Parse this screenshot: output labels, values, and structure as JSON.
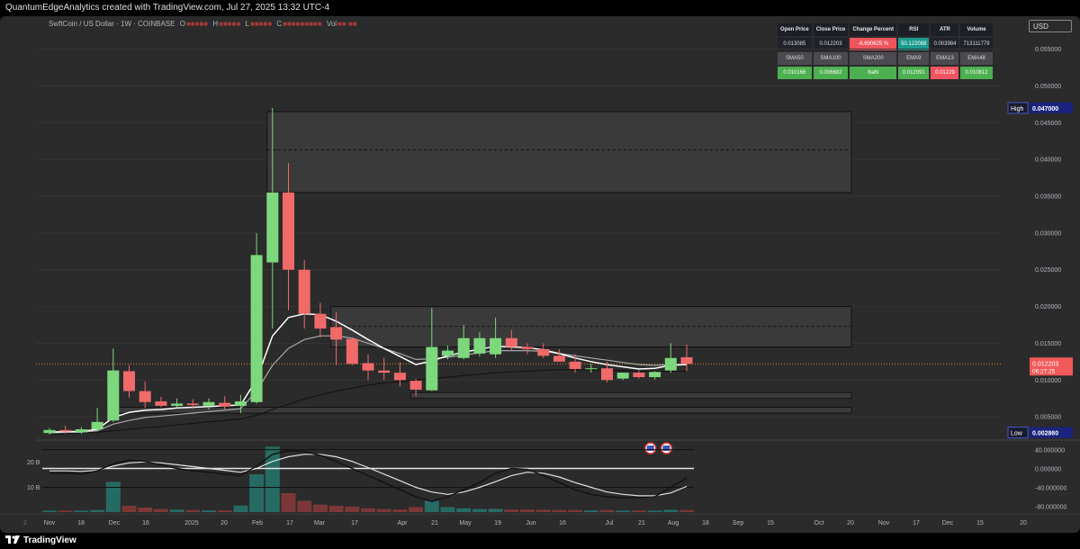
{
  "header": {
    "credit": "QuantumEdgeAnalytics created with TradingView.com, Jul 27, 2025 13:32 UTC-4",
    "symbol": "SwftCoin / US Dollar · 1W · COINBASE",
    "ohlc_labels": [
      "O",
      "H",
      "L",
      "C"
    ],
    "volume_label": "Vol",
    "currency": "USD",
    "brand": "TradingView"
  },
  "stats_table": {
    "headers": [
      "Open Price",
      "Close Price",
      "Change Percent",
      "RSI",
      "ATR",
      "Volume"
    ],
    "values": [
      "0.013085",
      "0.012203",
      "-6.690625 %",
      "50.122088",
      "0.003984",
      "713111779"
    ],
    "ma_headers": [
      "SMA50",
      "SMA100",
      "SMA200",
      "EMA9",
      "EMA13",
      "EMA48"
    ],
    "ma_values": [
      "0.010166",
      "0.006682",
      "NaN",
      "0.012091",
      "0.01229",
      "0.010812"
    ],
    "colors": {
      "negative": "#f0555f",
      "rsi": "#1b9b8e",
      "positive": "#4caf50"
    }
  },
  "chart_data": [
    {
      "type": "candlestick",
      "title": "SwftCoin / US Dollar · 1W · COINBASE",
      "ylim": [
        0.0022,
        0.0585
      ],
      "y_ticks": [
        "0.055000",
        "0.050000",
        "0.045000",
        "0.040000",
        "0.035000",
        "0.030000",
        "0.025000",
        "0.020000",
        "0.015000",
        "0.010000",
        "0.005000"
      ],
      "x_tick_labels": [
        "Nov",
        "18",
        "Dec",
        "16",
        "2025",
        "20",
        "Feb",
        "17",
        "Mar",
        "17",
        "Apr",
        "21",
        "May",
        "19",
        "Jun",
        "16",
        "Jul",
        "21",
        "Aug",
        "18",
        "Sep",
        "15",
        "Oct",
        "20",
        "Nov",
        "17",
        "Dec",
        "15",
        "20"
      ],
      "markers": {
        "high": {
          "label": "High",
          "value": "0.047000"
        },
        "low": {
          "label": "Low",
          "value": "0.002860"
        },
        "last": {
          "value": "0.012203",
          "countdown": "06:27:25"
        }
      },
      "colors": {
        "up": "#7dd87d",
        "down": "#f06a6a",
        "ema_fast": "#ffffff",
        "ema_slow": "#a8a8a8",
        "sma_long": "#111111",
        "last_line": "#d9883a"
      },
      "candles": [
        {
          "o": 0.0028,
          "h": 0.0035,
          "l": 0.0026,
          "c": 0.0032
        },
        {
          "o": 0.0032,
          "h": 0.0038,
          "l": 0.0027,
          "c": 0.003
        },
        {
          "o": 0.0029,
          "h": 0.0036,
          "l": 0.0027,
          "c": 0.0033
        },
        {
          "o": 0.0033,
          "h": 0.0062,
          "l": 0.0031,
          "c": 0.0043
        },
        {
          "o": 0.0045,
          "h": 0.0143,
          "l": 0.0043,
          "c": 0.0113
        },
        {
          "o": 0.0112,
          "h": 0.012,
          "l": 0.0076,
          "c": 0.0085
        },
        {
          "o": 0.0085,
          "h": 0.0098,
          "l": 0.0062,
          "c": 0.007
        },
        {
          "o": 0.0071,
          "h": 0.0077,
          "l": 0.0063,
          "c": 0.0065
        },
        {
          "o": 0.0065,
          "h": 0.0075,
          "l": 0.0062,
          "c": 0.0068
        },
        {
          "o": 0.0068,
          "h": 0.0074,
          "l": 0.0061,
          "c": 0.0066
        },
        {
          "o": 0.0065,
          "h": 0.0075,
          "l": 0.006,
          "c": 0.007
        },
        {
          "o": 0.0069,
          "h": 0.0078,
          "l": 0.006,
          "c": 0.0064
        },
        {
          "o": 0.0065,
          "h": 0.008,
          "l": 0.0055,
          "c": 0.0071
        },
        {
          "o": 0.007,
          "h": 0.03,
          "l": 0.0068,
          "c": 0.027
        },
        {
          "o": 0.026,
          "h": 0.047,
          "l": 0.017,
          "c": 0.0355
        },
        {
          "o": 0.0355,
          "h": 0.0395,
          "l": 0.0195,
          "c": 0.025
        },
        {
          "o": 0.025,
          "h": 0.0263,
          "l": 0.017,
          "c": 0.019
        },
        {
          "o": 0.019,
          "h": 0.0205,
          "l": 0.0158,
          "c": 0.017
        },
        {
          "o": 0.0172,
          "h": 0.0192,
          "l": 0.012,
          "c": 0.0155
        },
        {
          "o": 0.0156,
          "h": 0.0158,
          "l": 0.012,
          "c": 0.0122
        },
        {
          "o": 0.0123,
          "h": 0.0135,
          "l": 0.01,
          "c": 0.0113
        },
        {
          "o": 0.0113,
          "h": 0.013,
          "l": 0.01,
          "c": 0.011
        },
        {
          "o": 0.011,
          "h": 0.0124,
          "l": 0.0091,
          "c": 0.01
        },
        {
          "o": 0.0099,
          "h": 0.0102,
          "l": 0.0078,
          "c": 0.0087
        },
        {
          "o": 0.0086,
          "h": 0.0198,
          "l": 0.0085,
          "c": 0.0145
        },
        {
          "o": 0.0133,
          "h": 0.0147,
          "l": 0.0128,
          "c": 0.014
        },
        {
          "o": 0.013,
          "h": 0.0175,
          "l": 0.0128,
          "c": 0.0157
        },
        {
          "o": 0.0136,
          "h": 0.0165,
          "l": 0.0132,
          "c": 0.0157
        },
        {
          "o": 0.0135,
          "h": 0.0185,
          "l": 0.013,
          "c": 0.0157
        },
        {
          "o": 0.0157,
          "h": 0.0168,
          "l": 0.014,
          "c": 0.0145
        },
        {
          "o": 0.0145,
          "h": 0.015,
          "l": 0.0135,
          "c": 0.0142
        },
        {
          "o": 0.0142,
          "h": 0.015,
          "l": 0.013,
          "c": 0.0133
        },
        {
          "o": 0.0133,
          "h": 0.0142,
          "l": 0.0125,
          "c": 0.0125
        },
        {
          "o": 0.0125,
          "h": 0.0135,
          "l": 0.011,
          "c": 0.0115
        },
        {
          "o": 0.0115,
          "h": 0.0122,
          "l": 0.011,
          "c": 0.0116
        },
        {
          "o": 0.0116,
          "h": 0.0125,
          "l": 0.0097,
          "c": 0.01
        },
        {
          "o": 0.0102,
          "h": 0.011,
          "l": 0.01,
          "c": 0.011
        },
        {
          "o": 0.011,
          "h": 0.0113,
          "l": 0.0102,
          "c": 0.0104
        },
        {
          "o": 0.0104,
          "h": 0.0112,
          "l": 0.0101,
          "c": 0.0111
        },
        {
          "o": 0.0113,
          "h": 0.015,
          "l": 0.011,
          "c": 0.013
        },
        {
          "o": 0.0131,
          "h": 0.0148,
          "l": 0.0112,
          "c": 0.0122
        }
      ],
      "ema_fast": [
        0.0029,
        0.003,
        0.003,
        0.0033,
        0.0049,
        0.0056,
        0.0059,
        0.006,
        0.0062,
        0.0063,
        0.0064,
        0.0065,
        0.0066,
        0.0101,
        0.016,
        0.0185,
        0.019,
        0.0189,
        0.018,
        0.0168,
        0.0155,
        0.0143,
        0.0132,
        0.0121,
        0.0126,
        0.0133,
        0.0138,
        0.0142,
        0.0146,
        0.0145,
        0.0144,
        0.0141,
        0.0136,
        0.013,
        0.0125,
        0.0121,
        0.0118,
        0.0115,
        0.0116,
        0.012,
        0.0121
      ],
      "ema_slow": [
        0.0028,
        0.0029,
        0.0029,
        0.0031,
        0.004,
        0.0045,
        0.0049,
        0.0051,
        0.0053,
        0.0055,
        0.0057,
        0.0059,
        0.0061,
        0.0085,
        0.012,
        0.0143,
        0.0155,
        0.016,
        0.016,
        0.0157,
        0.015,
        0.0143,
        0.0136,
        0.0128,
        0.0129,
        0.0131,
        0.0134,
        0.0137,
        0.014,
        0.014,
        0.014,
        0.0139,
        0.0136,
        0.0133,
        0.013,
        0.0127,
        0.0124,
        0.0121,
        0.012,
        0.0121,
        0.0121
      ],
      "sma_long": [
        0.0026,
        0.0027,
        0.0028,
        0.0029,
        0.0031,
        0.0033,
        0.0035,
        0.0037,
        0.0039,
        0.0041,
        0.0043,
        0.0045,
        0.0047,
        0.0052,
        0.006,
        0.0067,
        0.0074,
        0.008,
        0.0085,
        0.0089,
        0.0093,
        0.0096,
        0.0098,
        0.01,
        0.0102,
        0.0104,
        0.0106,
        0.0108,
        0.011,
        0.0111,
        0.0112,
        0.0113,
        0.0114,
        0.0114,
        0.0114,
        0.0113,
        0.0113,
        0.0112,
        0.0112,
        0.0112,
        0.0112
      ],
      "zones": [
        {
          "from": 0.0355,
          "to": 0.0465,
          "mid": 0.0413,
          "start": 14
        },
        {
          "from": 0.0145,
          "to": 0.02,
          "mid": 0.0173,
          "start": 18
        },
        {
          "from": 0.0075,
          "to": 0.0083,
          "start": 23
        },
        {
          "from": 0.0055,
          "to": 0.0063,
          "start": 4
        }
      ]
    },
    {
      "type": "bar",
      "name": "volume",
      "y_ticks": [
        "20 B",
        "10 B"
      ],
      "ylim": [
        0,
        25
      ],
      "values": [
        0.6,
        0.6,
        0.6,
        0.8,
        12.0,
        2.5,
        1.8,
        1.2,
        1.0,
        0.8,
        0.7,
        0.7,
        2.6,
        15.0,
        26.0,
        7.5,
        4.5,
        3.0,
        2.5,
        2.2,
        1.5,
        1.2,
        1.0,
        2.0,
        4.5,
        2.0,
        1.5,
        1.2,
        1.3,
        1.0,
        1.0,
        0.9,
        0.8,
        0.8,
        0.7,
        0.8,
        0.6,
        0.6,
        0.6,
        0.9,
        0.8
      ],
      "up": [
        true,
        false,
        true,
        true,
        true,
        false,
        false,
        false,
        true,
        false,
        true,
        false,
        true,
        true,
        true,
        false,
        false,
        false,
        false,
        false,
        false,
        false,
        false,
        false,
        true,
        true,
        true,
        true,
        true,
        false,
        false,
        false,
        false,
        false,
        true,
        false,
        true,
        false,
        true,
        true,
        false
      ]
    },
    {
      "type": "line",
      "name": "oscillator",
      "y_ticks": [
        "40.000000",
        "0.000000",
        "-40.000000",
        "-80.000000"
      ],
      "ylim": [
        -85,
        45
      ],
      "series_a": [
        -10,
        -10,
        -12,
        -5,
        10,
        18,
        15,
        8,
        0,
        -5,
        -8,
        -12,
        -15,
        5,
        30,
        38,
        36,
        28,
        15,
        0,
        -15,
        -30,
        -45,
        -60,
        -70,
        -60,
        -45,
        -30,
        -10,
        0,
        -2,
        -15,
        -30,
        -45,
        -55,
        -60,
        -62,
        -62,
        -60,
        -40,
        -20
      ],
      "series_b": [
        -5,
        -5,
        -6,
        -4,
        5,
        12,
        14,
        12,
        8,
        4,
        0,
        -4,
        -8,
        0,
        15,
        25,
        30,
        30,
        25,
        15,
        2,
        -12,
        -26,
        -40,
        -50,
        -55,
        -50,
        -40,
        -28,
        -15,
        -8,
        -10,
        -18,
        -30,
        -40,
        -50,
        -55,
        -58,
        -58,
        -52,
        -38
      ]
    }
  ]
}
